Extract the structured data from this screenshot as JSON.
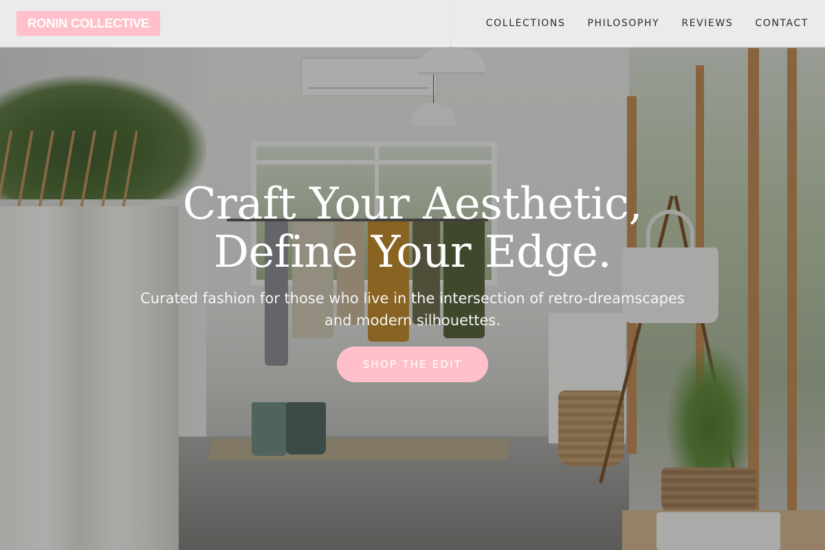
{
  "brand": {
    "name": "RONIN COLLECTIVE",
    "accent_color": "#ffc0cb"
  },
  "nav": {
    "items": [
      {
        "label": "COLLECTIONS"
      },
      {
        "label": "PHILOSOPHY"
      },
      {
        "label": "REVIEWS"
      },
      {
        "label": "CONTACT"
      }
    ]
  },
  "hero": {
    "title_line1": "Craft Your Aesthetic,",
    "title_line2": "Define Your Edge.",
    "subtitle_line1": "Curated fashion for those who live in the intersection of retro-dreamscapes",
    "subtitle_line2": "and modern silhouettes.",
    "cta_label": "SHOP THE EDIT",
    "background": "boutique-interior-photo"
  }
}
